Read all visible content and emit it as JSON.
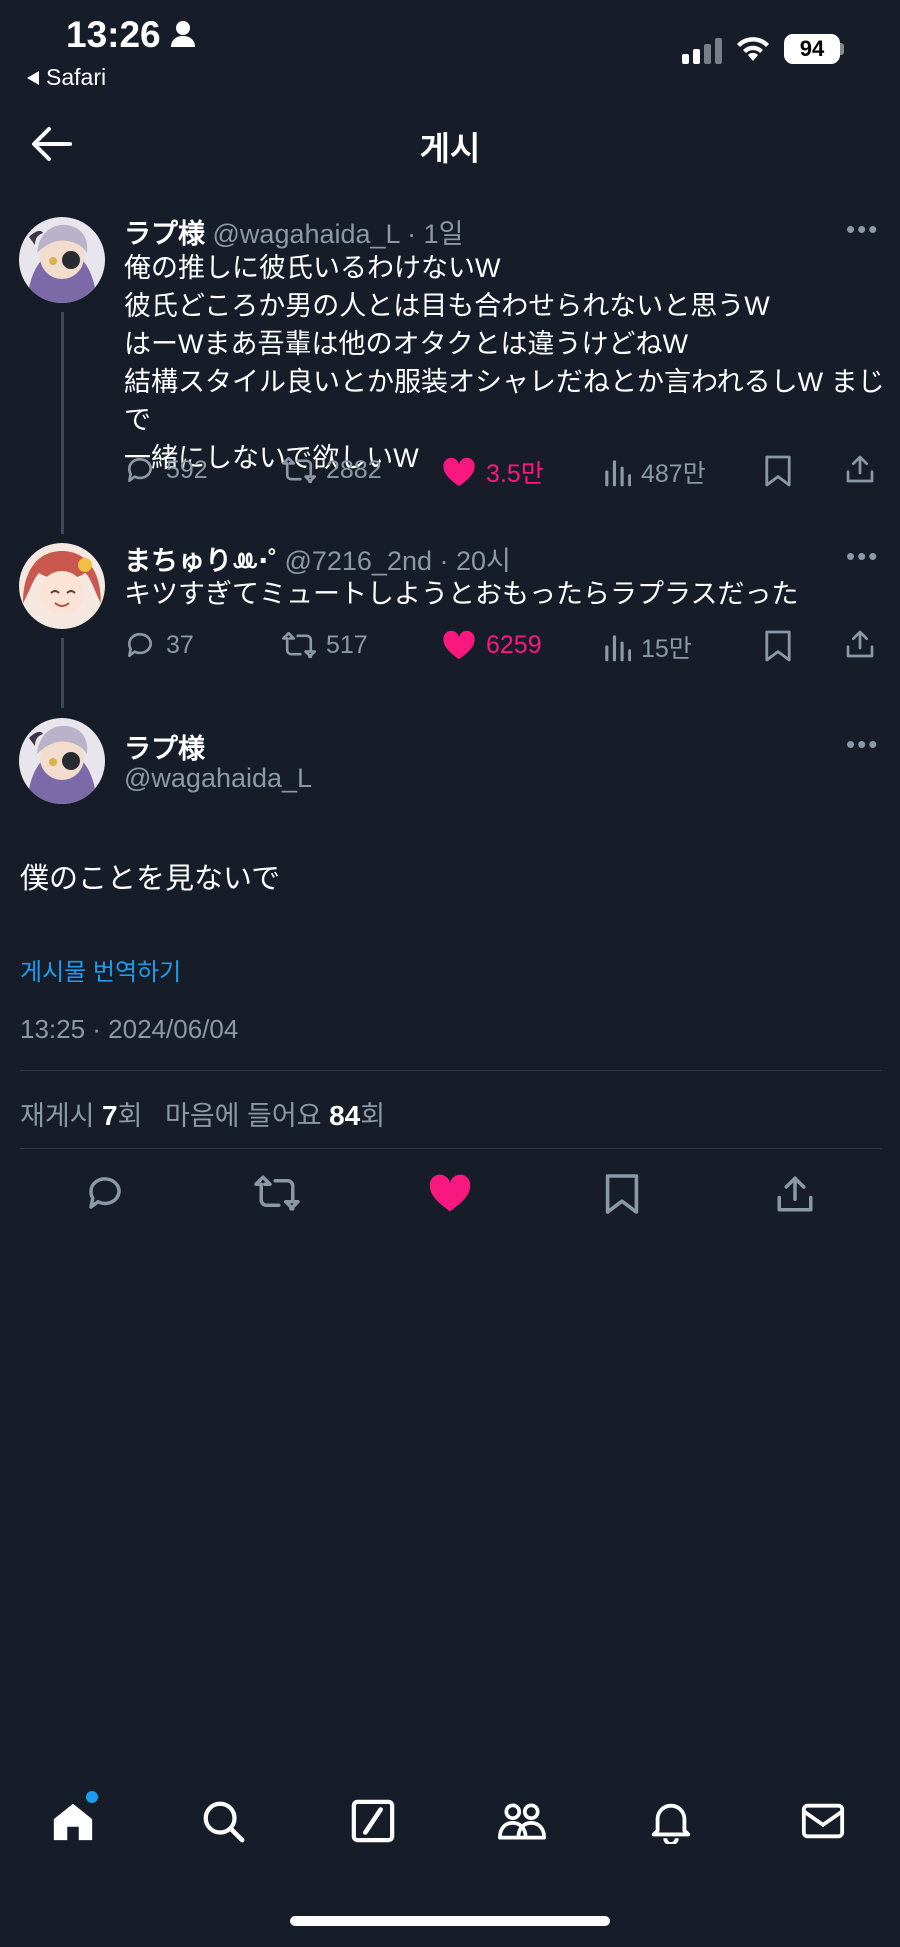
{
  "status_bar": {
    "time": "13:26",
    "back_app": "Safari",
    "battery": "94"
  },
  "header": {
    "title": "게시"
  },
  "thread": [
    {
      "name": "ラプ様",
      "handle": "@wagahaida_L",
      "time": "1일",
      "lines": [
        "俺の推しに彼氏いるわけないW",
        "彼氏どころか男の人とは目も合わせられないと思うW",
        "はーWまあ吾輩は他のオタクとは違うけどねW",
        "結構スタイル良いとか服装オシャレだねとか言われるしW まじで",
        "一緒にしないで欲しいW"
      ],
      "replies": "592",
      "reposts": "2882",
      "likes": "3.5만",
      "views": "487만"
    },
    {
      "name": "まちゅりꔛ‧˚",
      "handle": "@7216_2nd",
      "time": "20시",
      "lines": [
        "キツすぎてミュートしようとおもったらラプラスだった"
      ],
      "replies": "37",
      "reposts": "517",
      "likes": "6259",
      "views": "15만"
    }
  ],
  "main_post": {
    "name": "ラプ様",
    "handle": "@wagahaida_L",
    "text": "僕のことを見ないで",
    "translate": "게시물 번역하기",
    "timestamp": "13:25 · 2024/06/04",
    "repost_label": "재게시",
    "repost_count": "7",
    "count_unit": "회",
    "like_label": "마음에 들어요",
    "like_count": "84"
  },
  "icons": {
    "more": "more-icon",
    "reply": "reply-icon",
    "repost": "repost-icon",
    "like": "heart-icon",
    "views": "views-icon",
    "bookmark": "bookmark-icon",
    "share": "share-icon"
  },
  "colors": {
    "background": "#171d28",
    "like": "#f91880",
    "link": "#1d9bf0",
    "muted": "#8b98a5"
  }
}
